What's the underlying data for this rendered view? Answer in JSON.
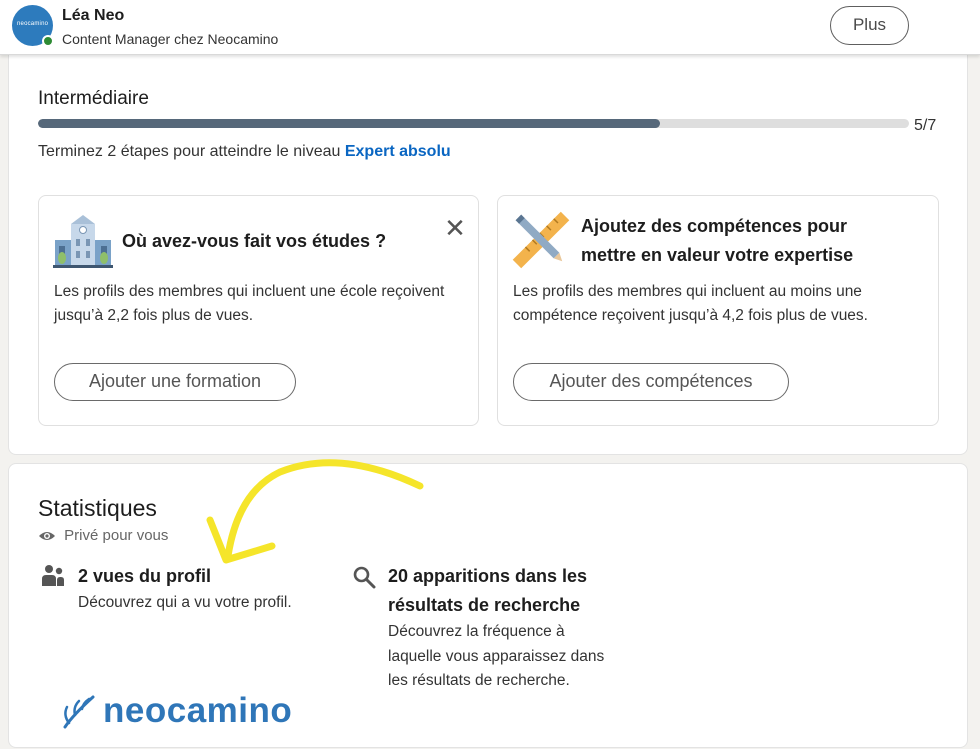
{
  "header": {
    "user_name": "Léa Neo",
    "headline": "Content Manager chez Neocamino",
    "avatar_text": "neocamino",
    "more_button": "Plus"
  },
  "profile_strength": {
    "level": "Intermédiaire",
    "progress_text": "5/7",
    "progress_fraction": 0.714,
    "hint_prefix": "Terminez 2 étapes pour atteindre le niveau ",
    "hint_link": "Expert absolu"
  },
  "suggestions": [
    {
      "icon": "school-building-icon",
      "title": "Où avez-vous fait vos études ?",
      "desc": "Les profils des membres qui incluent une école reçoivent jusqu’à 2,2 fois plus de vues.",
      "button": "Ajouter une formation",
      "close": "✕"
    },
    {
      "icon": "ruler-pencil-icon",
      "title": "Ajoutez des compétences pour mettre en valeur votre expertise",
      "desc": "Les profils des membres qui incluent au moins une compétence reçoivent jusqu’à 4,2 fois plus de vues.",
      "button": "Ajouter des compétences"
    }
  ],
  "statistics": {
    "title": "Statistiques",
    "private_label": "Privé pour vous",
    "items": [
      {
        "icon": "people-icon",
        "title": "2 vues du profil",
        "desc": "Découvrez qui a vu votre profil."
      },
      {
        "icon": "search-icon",
        "title": "20 apparitions dans les résultats de recherche",
        "desc": "Découvrez la fréquence à laquelle vous apparaissez dans les résultats de recherche."
      }
    ]
  },
  "brand": {
    "name": "neocamino",
    "color": "#2f76b8"
  },
  "colors": {
    "accent_link": "#0a66c2",
    "progress_fill": "#56687a",
    "annotation_arrow": "#f5e52a"
  }
}
